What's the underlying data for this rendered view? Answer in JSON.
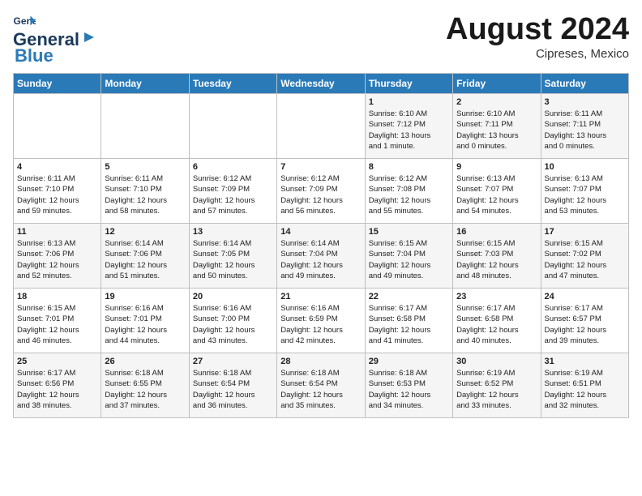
{
  "header": {
    "logo_line1": "General",
    "logo_line2": "Blue",
    "month_year": "August 2024",
    "location": "Cipreses, Mexico"
  },
  "weekdays": [
    "Sunday",
    "Monday",
    "Tuesday",
    "Wednesday",
    "Thursday",
    "Friday",
    "Saturday"
  ],
  "weeks": [
    [
      {
        "day": "",
        "info": ""
      },
      {
        "day": "",
        "info": ""
      },
      {
        "day": "",
        "info": ""
      },
      {
        "day": "",
        "info": ""
      },
      {
        "day": "1",
        "info": "Sunrise: 6:10 AM\nSunset: 7:12 PM\nDaylight: 13 hours\nand 1 minute."
      },
      {
        "day": "2",
        "info": "Sunrise: 6:10 AM\nSunset: 7:11 PM\nDaylight: 13 hours\nand 0 minutes."
      },
      {
        "day": "3",
        "info": "Sunrise: 6:11 AM\nSunset: 7:11 PM\nDaylight: 13 hours\nand 0 minutes."
      }
    ],
    [
      {
        "day": "4",
        "info": "Sunrise: 6:11 AM\nSunset: 7:10 PM\nDaylight: 12 hours\nand 59 minutes."
      },
      {
        "day": "5",
        "info": "Sunrise: 6:11 AM\nSunset: 7:10 PM\nDaylight: 12 hours\nand 58 minutes."
      },
      {
        "day": "6",
        "info": "Sunrise: 6:12 AM\nSunset: 7:09 PM\nDaylight: 12 hours\nand 57 minutes."
      },
      {
        "day": "7",
        "info": "Sunrise: 6:12 AM\nSunset: 7:09 PM\nDaylight: 12 hours\nand 56 minutes."
      },
      {
        "day": "8",
        "info": "Sunrise: 6:12 AM\nSunset: 7:08 PM\nDaylight: 12 hours\nand 55 minutes."
      },
      {
        "day": "9",
        "info": "Sunrise: 6:13 AM\nSunset: 7:07 PM\nDaylight: 12 hours\nand 54 minutes."
      },
      {
        "day": "10",
        "info": "Sunrise: 6:13 AM\nSunset: 7:07 PM\nDaylight: 12 hours\nand 53 minutes."
      }
    ],
    [
      {
        "day": "11",
        "info": "Sunrise: 6:13 AM\nSunset: 7:06 PM\nDaylight: 12 hours\nand 52 minutes."
      },
      {
        "day": "12",
        "info": "Sunrise: 6:14 AM\nSunset: 7:06 PM\nDaylight: 12 hours\nand 51 minutes."
      },
      {
        "day": "13",
        "info": "Sunrise: 6:14 AM\nSunset: 7:05 PM\nDaylight: 12 hours\nand 50 minutes."
      },
      {
        "day": "14",
        "info": "Sunrise: 6:14 AM\nSunset: 7:04 PM\nDaylight: 12 hours\nand 49 minutes."
      },
      {
        "day": "15",
        "info": "Sunrise: 6:15 AM\nSunset: 7:04 PM\nDaylight: 12 hours\nand 49 minutes."
      },
      {
        "day": "16",
        "info": "Sunrise: 6:15 AM\nSunset: 7:03 PM\nDaylight: 12 hours\nand 48 minutes."
      },
      {
        "day": "17",
        "info": "Sunrise: 6:15 AM\nSunset: 7:02 PM\nDaylight: 12 hours\nand 47 minutes."
      }
    ],
    [
      {
        "day": "18",
        "info": "Sunrise: 6:15 AM\nSunset: 7:01 PM\nDaylight: 12 hours\nand 46 minutes."
      },
      {
        "day": "19",
        "info": "Sunrise: 6:16 AM\nSunset: 7:01 PM\nDaylight: 12 hours\nand 44 minutes."
      },
      {
        "day": "20",
        "info": "Sunrise: 6:16 AM\nSunset: 7:00 PM\nDaylight: 12 hours\nand 43 minutes."
      },
      {
        "day": "21",
        "info": "Sunrise: 6:16 AM\nSunset: 6:59 PM\nDaylight: 12 hours\nand 42 minutes."
      },
      {
        "day": "22",
        "info": "Sunrise: 6:17 AM\nSunset: 6:58 PM\nDaylight: 12 hours\nand 41 minutes."
      },
      {
        "day": "23",
        "info": "Sunrise: 6:17 AM\nSunset: 6:58 PM\nDaylight: 12 hours\nand 40 minutes."
      },
      {
        "day": "24",
        "info": "Sunrise: 6:17 AM\nSunset: 6:57 PM\nDaylight: 12 hours\nand 39 minutes."
      }
    ],
    [
      {
        "day": "25",
        "info": "Sunrise: 6:17 AM\nSunset: 6:56 PM\nDaylight: 12 hours\nand 38 minutes."
      },
      {
        "day": "26",
        "info": "Sunrise: 6:18 AM\nSunset: 6:55 PM\nDaylight: 12 hours\nand 37 minutes."
      },
      {
        "day": "27",
        "info": "Sunrise: 6:18 AM\nSunset: 6:54 PM\nDaylight: 12 hours\nand 36 minutes."
      },
      {
        "day": "28",
        "info": "Sunrise: 6:18 AM\nSunset: 6:54 PM\nDaylight: 12 hours\nand 35 minutes."
      },
      {
        "day": "29",
        "info": "Sunrise: 6:18 AM\nSunset: 6:53 PM\nDaylight: 12 hours\nand 34 minutes."
      },
      {
        "day": "30",
        "info": "Sunrise: 6:19 AM\nSunset: 6:52 PM\nDaylight: 12 hours\nand 33 minutes."
      },
      {
        "day": "31",
        "info": "Sunrise: 6:19 AM\nSunset: 6:51 PM\nDaylight: 12 hours\nand 32 minutes."
      }
    ]
  ]
}
